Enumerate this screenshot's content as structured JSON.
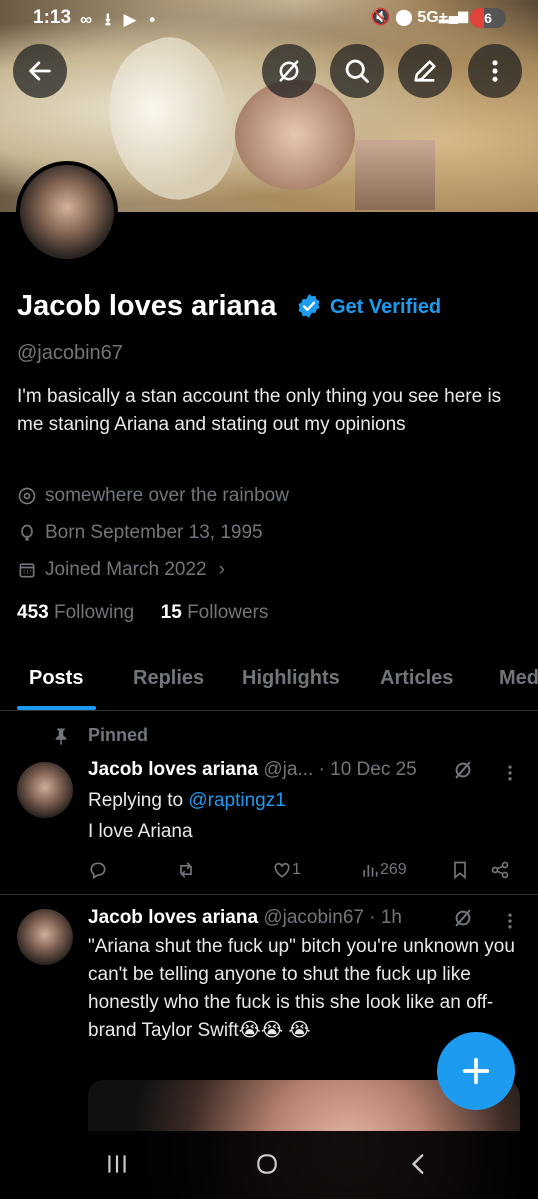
{
  "status_bar": {
    "time": "1:13",
    "network": "5G+",
    "battery": "6"
  },
  "profile": {
    "name": "Jacob loves ariana",
    "get_verified": "Get Verified",
    "handle": "@jacobin67",
    "bio": "I'm basically a stan account the only thing you see here is me staning Ariana and stating out my opinions",
    "location": "somewhere over the rainbow",
    "born": "Born September 13, 1995",
    "joined": "Joined March 2022",
    "following_count": "453",
    "following_label": "Following",
    "followers_count": "15",
    "followers_label": "Followers"
  },
  "tabs": [
    "Posts",
    "Replies",
    "Highlights",
    "Articles",
    "Med"
  ],
  "posts": [
    {
      "pinned_label": "Pinned",
      "author": "Jacob loves ariana",
      "handle_time": "@ja... · 10 Dec 25",
      "reply_prefix": "Replying to",
      "reply_to": "@raptingz1",
      "text": "I love Ariana",
      "likes": "1",
      "views": "269"
    },
    {
      "author": "Jacob loves ariana",
      "handle_time": "@jacobin67 · 1h",
      "text": "\"Ariana shut the fuck up\" bitch you're unknown you can't be telling anyone to shut the fuck up like honestly who the fuck is this she look like an off-brand Taylor Swift😭😭 😭"
    }
  ],
  "colors": {
    "accent": "#1d9bf0",
    "background": "#000000",
    "muted": "#71767b"
  }
}
